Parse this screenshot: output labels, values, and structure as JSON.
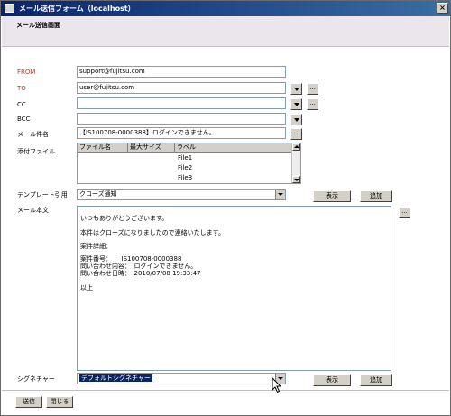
{
  "window": {
    "title": "メール送信フォーム（localhost）",
    "close_label": "×"
  },
  "header": {
    "page_title": "メール送信画面"
  },
  "fields": {
    "from": {
      "label": "FROM",
      "value": "support@fujitsu.com"
    },
    "to": {
      "label": "TO",
      "value": "user@fujitsu.com",
      "more_label": "..."
    },
    "cc": {
      "label": "CC",
      "value": "",
      "more_label": "..."
    },
    "bcc": {
      "label": "BCC",
      "value": ""
    },
    "subject": {
      "label": "メール件名",
      "value": "【IS100708-0000388】ログインできません。",
      "more_label": "..."
    }
  },
  "attachments": {
    "label": "添付ファイル",
    "columns": [
      "ファイル名",
      "最大サイズ",
      "ラベル"
    ],
    "rows": [
      {
        "name": "",
        "size": "",
        "label": "File1"
      },
      {
        "name": "",
        "size": "",
        "label": "File2"
      },
      {
        "name": "",
        "size": "",
        "label": "File3"
      }
    ]
  },
  "template": {
    "label": "テンプレート引用",
    "selected": "クローズ通知",
    "show_button": "表示",
    "add_button": "追加"
  },
  "body": {
    "label": "メール本文",
    "more_label": "...",
    "lines": [
      "いつもありがとうございます。",
      "本件はクローズになりましたので連絡いたします。",
      "案件詳細：",
      "案件番号：　　IS100708-0000388",
      "問い合わせ内容：　ログインできません。",
      "問い合わせ日時：　2010/07/08 19:33:47",
      "以上"
    ]
  },
  "signature": {
    "label": "シグネチャー",
    "selected": "デフォルトシグネチャー",
    "show_button": "表示",
    "add_button": "追加"
  },
  "footer": {
    "send_button": "送信",
    "close_button": "閉じる"
  },
  "colors": {
    "titlebar": "#0a246a",
    "header_band": "#ebe6ec",
    "required_label": "#c0392b",
    "field_border": "#7f9db9"
  },
  "icons": {
    "cursor": "arrow-pointer-icon",
    "dropdown": "chevron-down-icon"
  }
}
